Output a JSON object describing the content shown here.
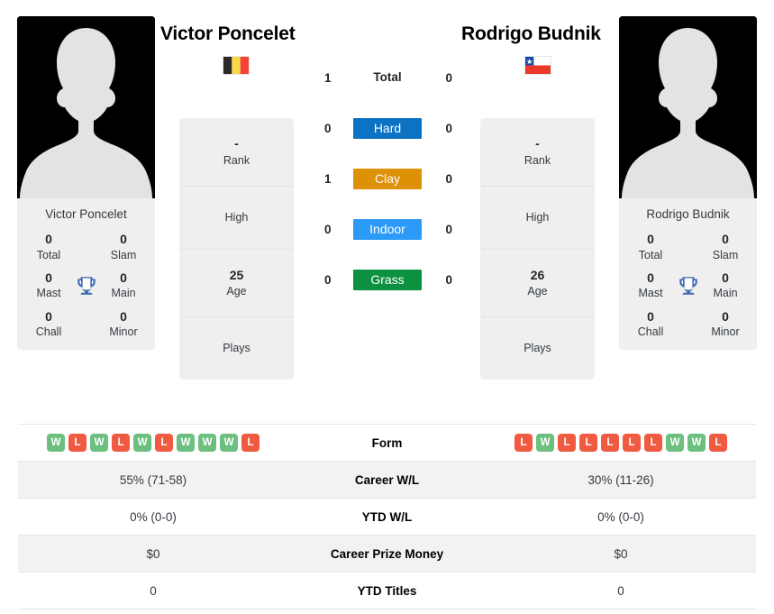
{
  "players": {
    "left": {
      "name": "Victor Poncelet",
      "photo_caption": "Victor Poncelet",
      "country": "Belgium",
      "flag_icon": "flag-belgium",
      "rank": "-",
      "rank_label": "Rank",
      "high_label": "High",
      "high_value": "",
      "age": "25",
      "age_label": "Age",
      "plays_label": "Plays",
      "plays_value": "",
      "titles": {
        "total": "0",
        "total_label": "Total",
        "slam": "0",
        "slam_label": "Slam",
        "mast": "0",
        "mast_label": "Mast",
        "main": "0",
        "main_label": "Main",
        "chall": "0",
        "chall_label": "Chall",
        "minor": "0",
        "minor_label": "Minor"
      },
      "surface_wins": {
        "total": "1",
        "hard": "0",
        "clay": "1",
        "indoor": "0",
        "grass": "0"
      },
      "form": [
        "W",
        "L",
        "W",
        "L",
        "W",
        "L",
        "W",
        "W",
        "W",
        "L"
      ],
      "career_wl": "55% (71-58)",
      "ytd_wl": "0% (0-0)",
      "career_prize_money": "$0",
      "ytd_titles": "0"
    },
    "right": {
      "name": "Rodrigo Budnik",
      "photo_caption": "Rodrigo Budnik",
      "country": "Chile",
      "flag_icon": "flag-chile",
      "rank": "-",
      "rank_label": "Rank",
      "high_label": "High",
      "high_value": "",
      "age": "26",
      "age_label": "Age",
      "plays_label": "Plays",
      "plays_value": "",
      "titles": {
        "total": "0",
        "total_label": "Total",
        "slam": "0",
        "slam_label": "Slam",
        "mast": "0",
        "mast_label": "Mast",
        "main": "0",
        "main_label": "Main",
        "chall": "0",
        "chall_label": "Chall",
        "minor": "0",
        "minor_label": "Minor"
      },
      "surface_wins": {
        "total": "0",
        "hard": "0",
        "clay": "0",
        "indoor": "0",
        "grass": "0"
      },
      "form": [
        "L",
        "W",
        "L",
        "L",
        "L",
        "L",
        "L",
        "W",
        "W",
        "L"
      ],
      "career_wl": "30% (11-26)",
      "ytd_wl": "0% (0-0)",
      "career_prize_money": "$0",
      "ytd_titles": "0"
    }
  },
  "surface_rows": [
    {
      "key": "total",
      "label": "Total",
      "type": "plain"
    },
    {
      "key": "hard",
      "label": "Hard",
      "type": "badge",
      "color": "#0b72c4"
    },
    {
      "key": "clay",
      "label": "Clay",
      "type": "badge",
      "color": "#dd9106"
    },
    {
      "key": "indoor",
      "label": "Indoor",
      "type": "badge",
      "color": "#2c9bf7"
    },
    {
      "key": "grass",
      "label": "Grass",
      "type": "badge",
      "color": "#0c9140"
    }
  ],
  "comparison_rows": [
    {
      "label": "Form",
      "key": "form",
      "type": "form"
    },
    {
      "label": "Career W/L",
      "key": "career_wl",
      "type": "text"
    },
    {
      "label": "YTD W/L",
      "key": "ytd_wl",
      "type": "text"
    },
    {
      "label": "Career Prize Money",
      "key": "career_prize_money",
      "type": "text"
    },
    {
      "label": "YTD Titles",
      "key": "ytd_titles",
      "type": "text"
    }
  ],
  "colors": {
    "win": "#6cbf7f",
    "loss": "#f05a41",
    "hard": "#0b72c4",
    "clay": "#dd9106",
    "indoor": "#2c9bf7",
    "grass": "#0c9140",
    "card_bg": "#efefef",
    "row_shade": "#f2f2f2",
    "trophy": "#3d6ab3"
  },
  "icons": {
    "trophy": "trophy-icon",
    "avatar": "avatar-silhouette-icon"
  }
}
